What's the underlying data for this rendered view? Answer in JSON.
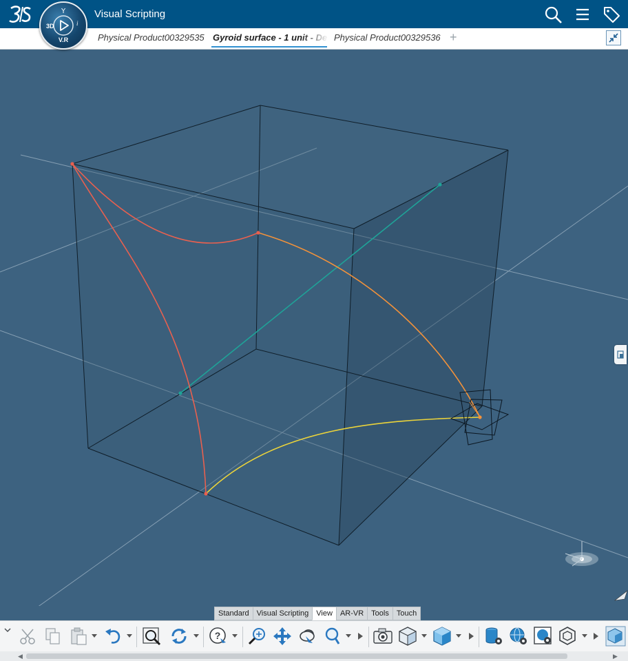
{
  "header": {
    "brand_icon": "3ds-logo-icon",
    "compass": {
      "top_glyph": "Y",
      "left_label": "3D",
      "right_label": "i",
      "bottom_label": "V.R"
    },
    "app_title": "Visual Scripting",
    "icons": [
      "search-icon",
      "menu-icon",
      "tag-icon"
    ]
  },
  "tabs": {
    "items": [
      {
        "label": "Physical Product00329535",
        "active": false
      },
      {
        "label": "Gyroid surface - 1 unit - De",
        "active": true
      },
      {
        "label": "Physical Product00329536",
        "active": false
      }
    ],
    "add_label": "+"
  },
  "viewport": {
    "background": "#3d6280",
    "curve_colors": {
      "red": "#e8604f",
      "orange": "#f3923a",
      "yellow": "#ecd43a",
      "teal": "#1fa398"
    }
  },
  "toolbar": {
    "tabs": [
      "Standard",
      "Visual Scripting",
      "View",
      "AR-VR",
      "Tools",
      "Touch"
    ],
    "active_tab": "View",
    "tools": [
      "cut-icon",
      "copy-icon",
      "paste-icon",
      "undo-icon",
      "zoom-fit-icon",
      "rotate-icon",
      "help-icon",
      "zoom-icon",
      "pan-icon",
      "rotate-view-icon",
      "zoom-area-icon",
      "capture-icon",
      "view-mode-icon",
      "shading-icon",
      "database-settings-icon",
      "globe-settings-icon",
      "image-settings-icon",
      "hexagon-icon",
      "view-cube-icon"
    ]
  }
}
